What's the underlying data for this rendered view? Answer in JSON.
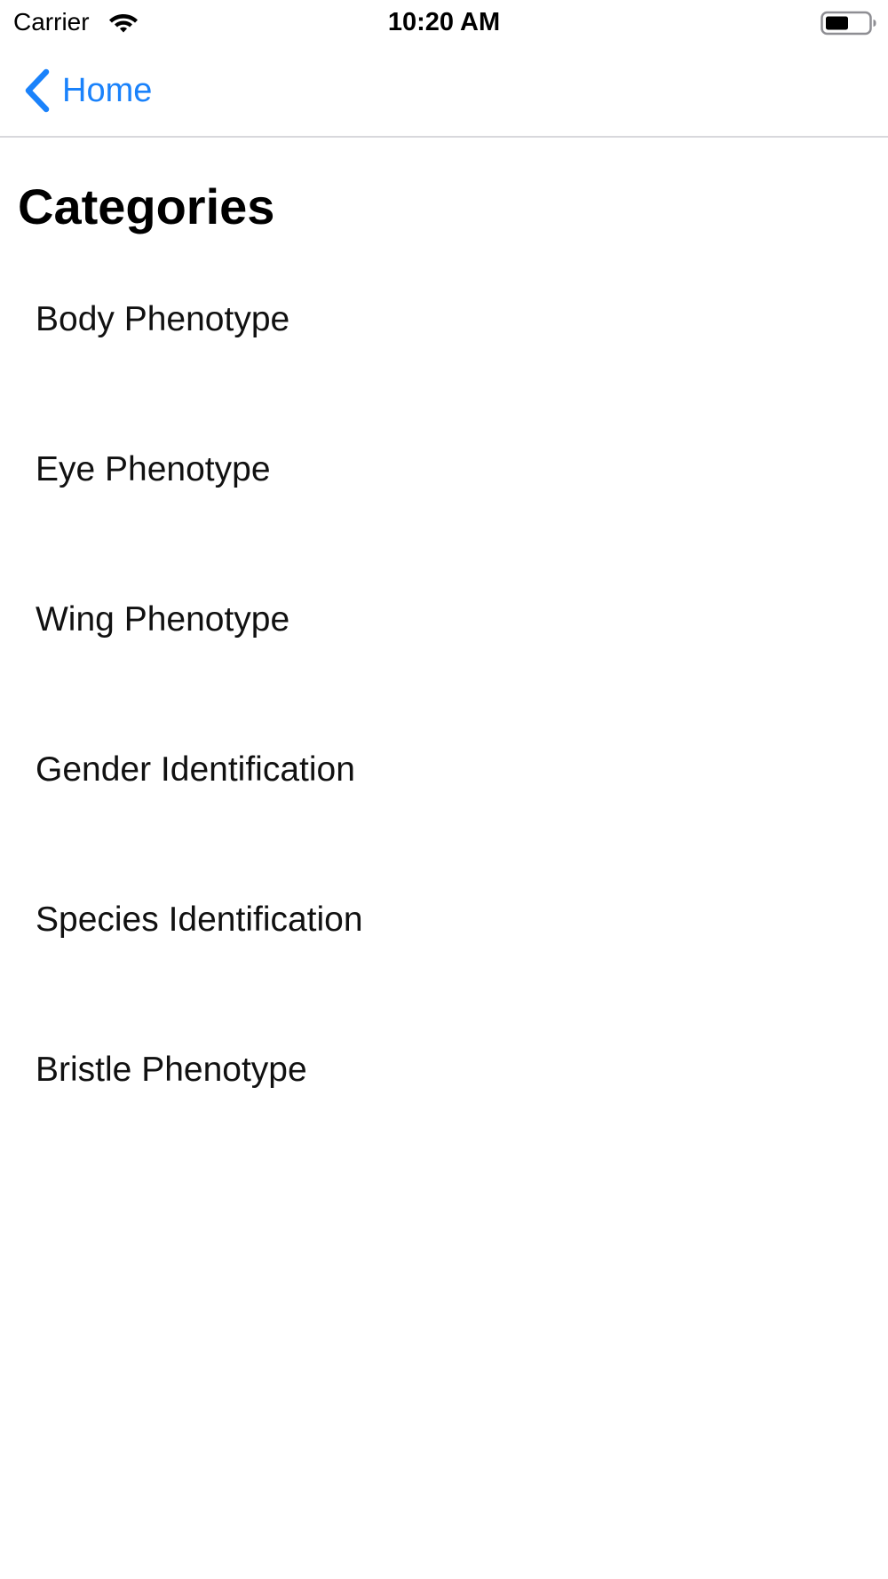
{
  "status_bar": {
    "carrier": "Carrier",
    "time": "10:20 AM",
    "icons": [
      "wifi-icon",
      "battery-icon"
    ]
  },
  "nav_bar": {
    "back_label": "Home",
    "back_icon": "chevron-left-icon",
    "accent_color": "#1a82fb"
  },
  "page": {
    "title": "Categories"
  },
  "categories": {
    "items": [
      {
        "label": "Body Phenotype"
      },
      {
        "label": "Eye Phenotype"
      },
      {
        "label": "Wing Phenotype"
      },
      {
        "label": "Gender Identification"
      },
      {
        "label": "Species Identification"
      },
      {
        "label": "Bristle Phenotype"
      }
    ]
  }
}
